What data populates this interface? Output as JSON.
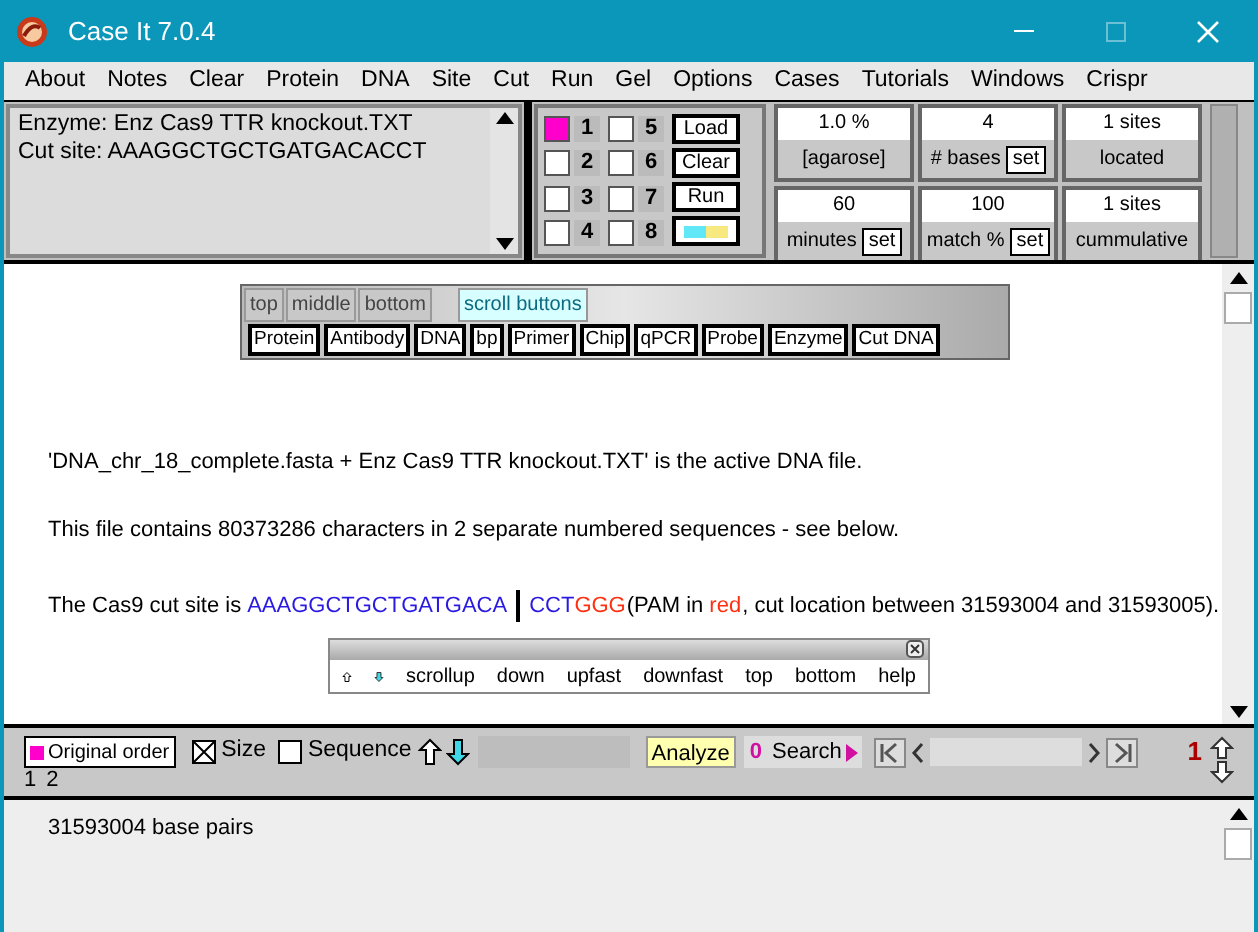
{
  "window": {
    "title": "Case It 7.0.4"
  },
  "menu": [
    "About",
    "Notes",
    "Clear",
    "Protein",
    "DNA",
    "Site",
    "Cut",
    "Run",
    "Gel",
    "Options",
    "Cases",
    "Tutorials",
    "Windows",
    "Crispr"
  ],
  "info_lines": [
    "Enzyme: Enz Cas9 TTR knockout.TXT",
    "Cut site: AAAGGCTGCTGATGACACCT"
  ],
  "lanes": [
    {
      "number": "1",
      "checked": true
    },
    {
      "number": "2",
      "checked": false
    },
    {
      "number": "3",
      "checked": false
    },
    {
      "number": "4",
      "checked": false
    },
    {
      "number": "5",
      "checked": false
    },
    {
      "number": "6",
      "checked": false
    },
    {
      "number": "7",
      "checked": false
    },
    {
      "number": "8",
      "checked": false
    }
  ],
  "lane_buttons": [
    "Load",
    "Clear",
    "Run"
  ],
  "settings": [
    [
      {
        "value": "1.0 %",
        "label": "[agarose]"
      },
      {
        "value": "60",
        "label": "minutes",
        "button": "set"
      }
    ],
    [
      {
        "value": "4",
        "label": "# bases",
        "button": "set"
      },
      {
        "value": "100",
        "label": "match %",
        "button": "set"
      }
    ],
    [
      {
        "value": "1  sites",
        "label": "located"
      },
      {
        "value": "1  sites",
        "label": "cummulative"
      }
    ]
  ],
  "palette": {
    "tabs": [
      {
        "label": "top",
        "selected": false
      },
      {
        "label": "middle",
        "selected": false
      },
      {
        "label": "bottom",
        "selected": false
      },
      {
        "label": "scroll buttons",
        "selected": true
      }
    ],
    "buttons": [
      "Protein",
      "Antibody",
      "DNA",
      "bp",
      "Primer",
      "Chip",
      "qPCR",
      "Probe",
      "Enzyme",
      "Cut DNA"
    ]
  },
  "paragraphs": [
    [
      {
        "kind": "plain",
        "text": "'DNA_chr_18_complete.fasta + Enz Cas9 TTR knockout.TXT' is the active DNA file."
      }
    ],
    [
      {
        "kind": "plain",
        "text": "This file contains 80373286 characters in 2 separate numbered sequences - see below."
      }
    ],
    [
      {
        "kind": "plain",
        "text": "The Cas9 cut site is"
      },
      {
        "kind": "site",
        "text": "AAAGGCTGCTGATGACA"
      },
      {
        "kind": "cut"
      },
      {
        "kind": "site",
        "text": "CCT"
      },
      {
        "kind": "pam",
        "text": "GGG"
      },
      {
        "kind": "plain",
        "text": "(PAM in"
      },
      {
        "kind": "pam",
        "text": "red"
      },
      {
        "kind": "plain",
        "text": ", cut location between 31593004 and 31593005)."
      }
    ]
  ],
  "scroll_palette": [
    "scrollup",
    "down",
    "upfast",
    "downfast",
    "top",
    "bottom",
    "help"
  ],
  "toolbar": {
    "order_button": "Original order",
    "size": {
      "label": "Size",
      "checked": true
    },
    "sequence": {
      "label": "Sequence",
      "checked": false
    },
    "analyze": "Analyze",
    "search_count": "0",
    "search": "Search",
    "counter": "1",
    "sequence_numbers": [
      "1",
      "2"
    ]
  },
  "output": "31593004 base pairs"
}
